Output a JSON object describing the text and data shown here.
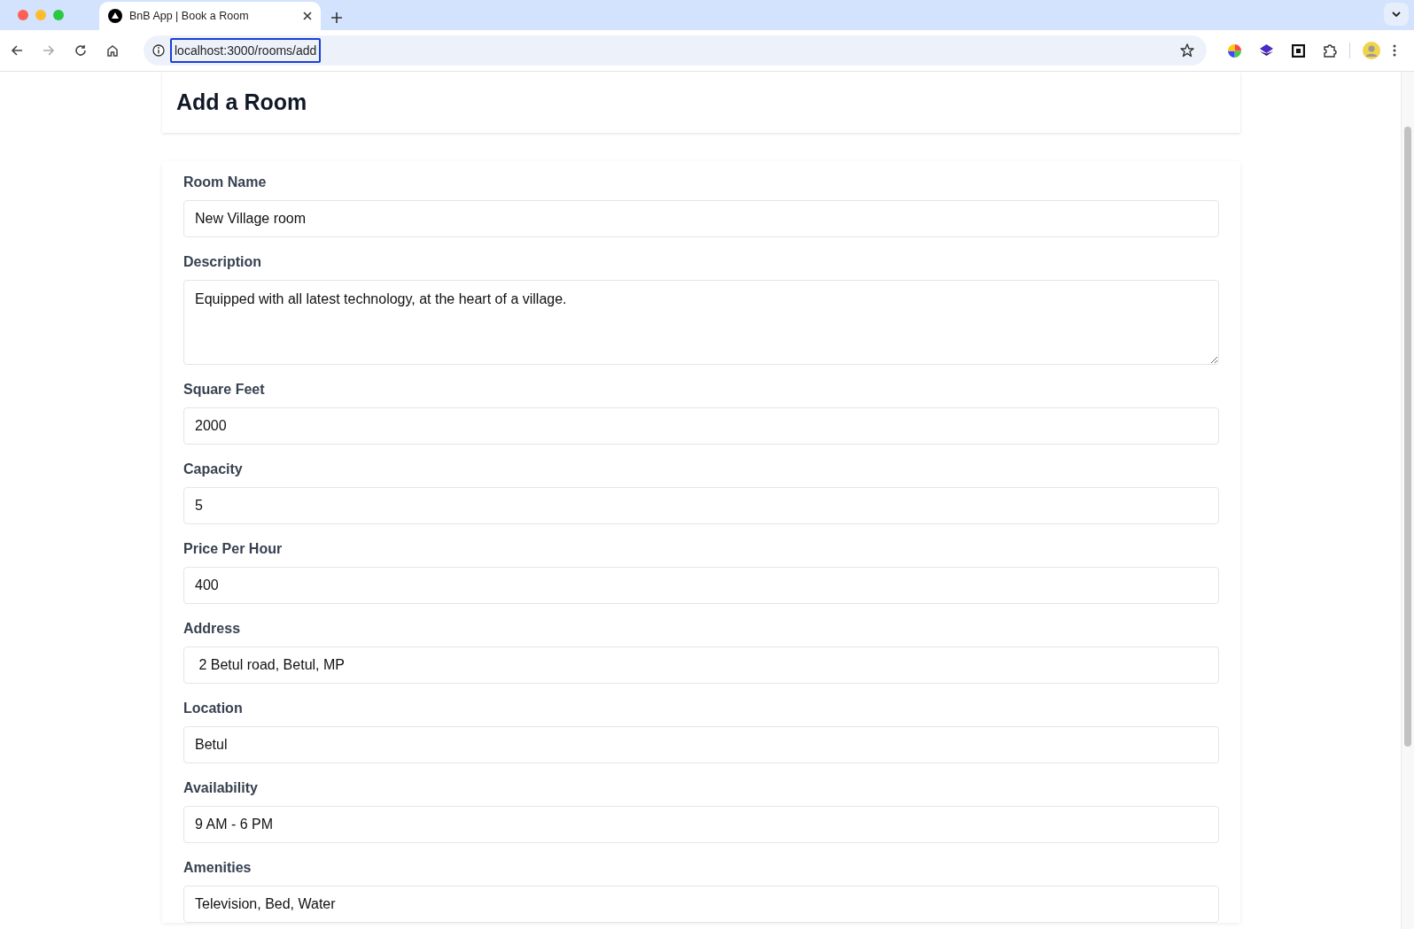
{
  "browser": {
    "tab": {
      "title": "BnB App | Book a Room",
      "selected": true
    },
    "address": "localhost:3000/rooms/add"
  },
  "page": {
    "title": "Add a Room"
  },
  "fields": [
    {
      "label": "Room Name",
      "kind": "input",
      "value": "New Village room"
    },
    {
      "label": "Description",
      "kind": "textarea",
      "value": "Equipped with all latest technology, at the heart of a village."
    },
    {
      "label": "Square Feet",
      "kind": "input",
      "value": "2000"
    },
    {
      "label": "Capacity",
      "kind": "input",
      "value": "5"
    },
    {
      "label": "Price Per Hour",
      "kind": "input",
      "value": "400"
    },
    {
      "label": "Address",
      "kind": "input",
      "value": " 2 Betul road, Betul, MP"
    },
    {
      "label": "Location",
      "kind": "input",
      "value": "Betul"
    },
    {
      "label": "Availability",
      "kind": "input",
      "value": "9 AM - 6 PM"
    },
    {
      "label": "Amenities",
      "kind": "input",
      "value": "Television, Bed, Water"
    }
  ]
}
